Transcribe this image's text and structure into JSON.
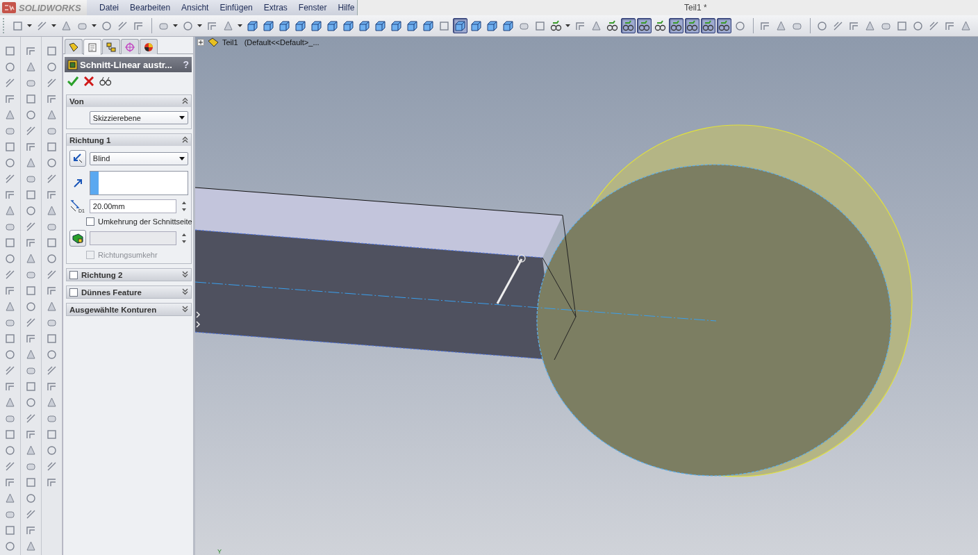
{
  "app": {
    "logo": "SOLIDWORKS",
    "document_title": "Teil1 *"
  },
  "menu": [
    "Datei",
    "Bearbeiten",
    "Ansicht",
    "Einfügen",
    "Extras",
    "Fenster",
    "Hilfe"
  ],
  "toolbar": {
    "items": [
      {
        "kind": "tool",
        "selected": false
      },
      {
        "kind": "caret"
      },
      {
        "kind": "tool",
        "selected": false
      },
      {
        "kind": "caret"
      },
      {
        "kind": "tool",
        "selected": false
      },
      {
        "kind": "tool",
        "selected": false
      },
      {
        "kind": "caret"
      },
      {
        "kind": "tool",
        "selected": false
      },
      {
        "kind": "tool",
        "selected": false
      },
      {
        "kind": "tool",
        "selected": false
      },
      {
        "kind": "sep"
      },
      {
        "kind": "tool",
        "selected": false
      },
      {
        "kind": "caret"
      },
      {
        "kind": "tool",
        "selected": false
      },
      {
        "kind": "caret"
      },
      {
        "kind": "tool",
        "selected": false
      },
      {
        "kind": "tool",
        "selected": false
      },
      {
        "kind": "caret"
      },
      {
        "kind": "cube",
        "selected": false
      },
      {
        "kind": "cube",
        "selected": false
      },
      {
        "kind": "cube",
        "selected": false
      },
      {
        "kind": "cube",
        "selected": false
      },
      {
        "kind": "cube",
        "selected": false
      },
      {
        "kind": "cube",
        "selected": false
      },
      {
        "kind": "cube",
        "selected": false
      },
      {
        "kind": "cube",
        "selected": false
      },
      {
        "kind": "cube",
        "selected": false
      },
      {
        "kind": "cube",
        "selected": false
      },
      {
        "kind": "cube",
        "selected": false
      },
      {
        "kind": "cube",
        "selected": false
      },
      {
        "kind": "tool",
        "selected": false
      },
      {
        "kind": "cube",
        "selected": true
      },
      {
        "kind": "cube",
        "selected": false
      },
      {
        "kind": "cube",
        "selected": false
      },
      {
        "kind": "cube",
        "selected": false
      },
      {
        "kind": "tool",
        "selected": false
      },
      {
        "kind": "tool",
        "selected": false
      },
      {
        "kind": "glasses",
        "selected": false
      },
      {
        "kind": "caret"
      },
      {
        "kind": "tool",
        "selected": false
      },
      {
        "kind": "tool",
        "selected": false
      },
      {
        "kind": "glasses",
        "selected": false
      },
      {
        "kind": "glasses",
        "selected": true
      },
      {
        "kind": "glasses",
        "selected": true
      },
      {
        "kind": "glasses",
        "selected": false
      },
      {
        "kind": "glasses",
        "selected": true
      },
      {
        "kind": "glasses",
        "selected": true
      },
      {
        "kind": "glasses",
        "selected": true
      },
      {
        "kind": "glasses",
        "selected": true
      },
      {
        "kind": "tool",
        "selected": false
      },
      {
        "kind": "sep"
      },
      {
        "kind": "tool",
        "selected": false
      },
      {
        "kind": "tool",
        "selected": false
      },
      {
        "kind": "tool",
        "selected": false
      },
      {
        "kind": "sep"
      },
      {
        "kind": "tool",
        "selected": false
      },
      {
        "kind": "tool",
        "selected": false
      },
      {
        "kind": "tool",
        "selected": false
      },
      {
        "kind": "tool",
        "selected": false
      },
      {
        "kind": "tool",
        "selected": false
      },
      {
        "kind": "tool",
        "selected": false
      },
      {
        "kind": "tool",
        "selected": false
      },
      {
        "kind": "tool",
        "selected": false
      },
      {
        "kind": "tool",
        "selected": false
      },
      {
        "kind": "tool",
        "selected": false
      }
    ]
  },
  "property_manager": {
    "tabs": [
      {
        "kind": "feature-tree",
        "selected": false
      },
      {
        "kind": "property",
        "selected": true
      },
      {
        "kind": "configuration",
        "selected": false
      },
      {
        "kind": "target",
        "selected": false
      },
      {
        "kind": "appearance",
        "selected": false
      }
    ],
    "title": "Schnitt-Linear austr...",
    "help": "?",
    "sections": [
      {
        "title": "Von",
        "expanded": true,
        "rows": [
          {
            "kind": "dropdown",
            "value": "Skizzierebene"
          }
        ]
      },
      {
        "title": "Richtung 1",
        "expanded": true,
        "rows": [
          {
            "kind": "end-condition",
            "value": "Blind"
          },
          {
            "kind": "selection-list"
          },
          {
            "kind": "depth",
            "value": "20.00mm",
            "symbol": "D1"
          },
          {
            "kind": "checkbox",
            "label": "Umkehrung der Schnittseite",
            "checked": false,
            "disabled": false
          },
          {
            "kind": "draft",
            "disabled": true
          },
          {
            "kind": "checkbox",
            "label": "Richtungsumkehr",
            "checked": false,
            "disabled": true
          }
        ]
      },
      {
        "title": "Richtung 2",
        "expanded": false,
        "checkbox": {
          "checked": false
        }
      },
      {
        "title": "Dünnes Feature",
        "expanded": false,
        "checkbox": {
          "checked": false
        }
      },
      {
        "title": "Ausgewählte Konturen",
        "expanded": false
      }
    ]
  },
  "viewport": {
    "tree": {
      "root": "Teil1",
      "config": "(Default<<Default>_...",
      "expanded": false
    },
    "triad_label": "Y"
  }
}
